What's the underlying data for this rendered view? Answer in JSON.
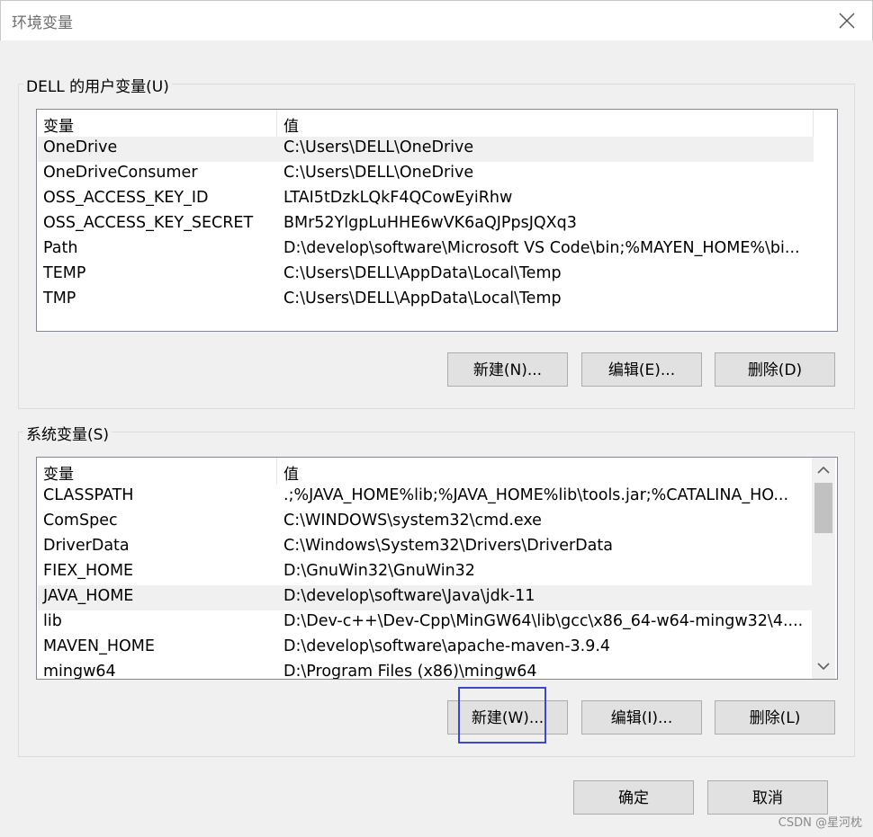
{
  "window": {
    "title": "环境变量",
    "close_icon": "close-icon"
  },
  "user_vars": {
    "group_label": "DELL 的用户变量(U)",
    "col_name": "变量",
    "col_value": "值",
    "rows": [
      {
        "name": "OneDrive",
        "value": "C:\\Users\\DELL\\OneDrive"
      },
      {
        "name": "OneDriveConsumer",
        "value": "C:\\Users\\DELL\\OneDrive"
      },
      {
        "name": "OSS_ACCESS_KEY_ID",
        "value": "LTAI5tDzkLQkF4QCowEyiRhw"
      },
      {
        "name": "OSS_ACCESS_KEY_SECRET",
        "value": "BMr52YlgpLuHHE6wVK6aQJPpsJQXq3"
      },
      {
        "name": "Path",
        "value": "D:\\develop\\software\\Microsoft VS Code\\bin;%MAYEN_HOME%\\bi..."
      },
      {
        "name": "TEMP",
        "value": "C:\\Users\\DELL\\AppData\\Local\\Temp"
      },
      {
        "name": "TMP",
        "value": "C:\\Users\\DELL\\AppData\\Local\\Temp"
      }
    ],
    "buttons": {
      "new": "新建(N)...",
      "edit": "编辑(E)...",
      "delete": "删除(D)"
    }
  },
  "system_vars": {
    "group_label": "系统变量(S)",
    "col_name": "变量",
    "col_value": "值",
    "rows": [
      {
        "name": "CLASSPATH",
        "value": ".;%JAVA_HOME%lib;%JAVA_HOME%lib\\tools.jar;%CATALINA_HO..."
      },
      {
        "name": "ComSpec",
        "value": "C:\\WINDOWS\\system32\\cmd.exe"
      },
      {
        "name": "DriverData",
        "value": "C:\\Windows\\System32\\Drivers\\DriverData"
      },
      {
        "name": "FIEX_HOME",
        "value": "D:\\GnuWin32\\GnuWin32"
      },
      {
        "name": "JAVA_HOME",
        "value": "D:\\develop\\software\\Java\\jdk-11"
      },
      {
        "name": "lib",
        "value": "D:\\Dev-c++\\Dev-Cpp\\MinGW64\\lib\\gcc\\x86_64-w64-mingw32\\4...."
      },
      {
        "name": "MAVEN_HOME",
        "value": "D:\\develop\\software\\apache-maven-3.9.4"
      },
      {
        "name": "mingw64",
        "value": "D:\\Program Files (x86)\\mingw64"
      }
    ],
    "buttons": {
      "new": "新建(W)...",
      "edit": "编辑(I)...",
      "delete": "删除(L)"
    }
  },
  "dialog_buttons": {
    "ok": "确定",
    "cancel": "取消"
  },
  "watermark": "CSDN @星河枕"
}
